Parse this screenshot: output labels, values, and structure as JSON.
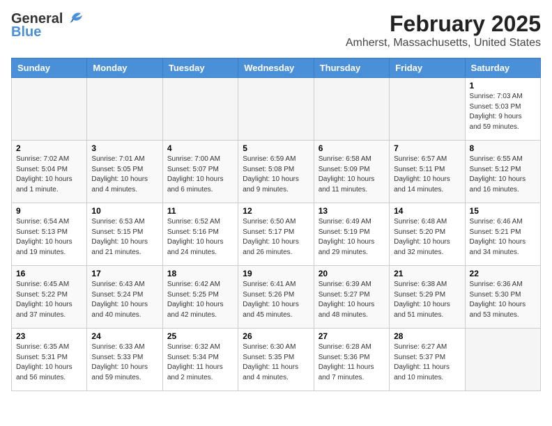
{
  "app": {
    "logo_general": "General",
    "logo_blue": "Blue",
    "title": "February 2025",
    "subtitle": "Amherst, Massachusetts, United States"
  },
  "calendar": {
    "headers": [
      "Sunday",
      "Monday",
      "Tuesday",
      "Wednesday",
      "Thursday",
      "Friday",
      "Saturday"
    ],
    "weeks": [
      [
        {
          "day": "",
          "info": ""
        },
        {
          "day": "",
          "info": ""
        },
        {
          "day": "",
          "info": ""
        },
        {
          "day": "",
          "info": ""
        },
        {
          "day": "",
          "info": ""
        },
        {
          "day": "",
          "info": ""
        },
        {
          "day": "1",
          "info": "Sunrise: 7:03 AM\nSunset: 5:03 PM\nDaylight: 9 hours\nand 59 minutes."
        }
      ],
      [
        {
          "day": "2",
          "info": "Sunrise: 7:02 AM\nSunset: 5:04 PM\nDaylight: 10 hours\nand 1 minute."
        },
        {
          "day": "3",
          "info": "Sunrise: 7:01 AM\nSunset: 5:05 PM\nDaylight: 10 hours\nand 4 minutes."
        },
        {
          "day": "4",
          "info": "Sunrise: 7:00 AM\nSunset: 5:07 PM\nDaylight: 10 hours\nand 6 minutes."
        },
        {
          "day": "5",
          "info": "Sunrise: 6:59 AM\nSunset: 5:08 PM\nDaylight: 10 hours\nand 9 minutes."
        },
        {
          "day": "6",
          "info": "Sunrise: 6:58 AM\nSunset: 5:09 PM\nDaylight: 10 hours\nand 11 minutes."
        },
        {
          "day": "7",
          "info": "Sunrise: 6:57 AM\nSunset: 5:11 PM\nDaylight: 10 hours\nand 14 minutes."
        },
        {
          "day": "8",
          "info": "Sunrise: 6:55 AM\nSunset: 5:12 PM\nDaylight: 10 hours\nand 16 minutes."
        }
      ],
      [
        {
          "day": "9",
          "info": "Sunrise: 6:54 AM\nSunset: 5:13 PM\nDaylight: 10 hours\nand 19 minutes."
        },
        {
          "day": "10",
          "info": "Sunrise: 6:53 AM\nSunset: 5:15 PM\nDaylight: 10 hours\nand 21 minutes."
        },
        {
          "day": "11",
          "info": "Sunrise: 6:52 AM\nSunset: 5:16 PM\nDaylight: 10 hours\nand 24 minutes."
        },
        {
          "day": "12",
          "info": "Sunrise: 6:50 AM\nSunset: 5:17 PM\nDaylight: 10 hours\nand 26 minutes."
        },
        {
          "day": "13",
          "info": "Sunrise: 6:49 AM\nSunset: 5:19 PM\nDaylight: 10 hours\nand 29 minutes."
        },
        {
          "day": "14",
          "info": "Sunrise: 6:48 AM\nSunset: 5:20 PM\nDaylight: 10 hours\nand 32 minutes."
        },
        {
          "day": "15",
          "info": "Sunrise: 6:46 AM\nSunset: 5:21 PM\nDaylight: 10 hours\nand 34 minutes."
        }
      ],
      [
        {
          "day": "16",
          "info": "Sunrise: 6:45 AM\nSunset: 5:22 PM\nDaylight: 10 hours\nand 37 minutes."
        },
        {
          "day": "17",
          "info": "Sunrise: 6:43 AM\nSunset: 5:24 PM\nDaylight: 10 hours\nand 40 minutes."
        },
        {
          "day": "18",
          "info": "Sunrise: 6:42 AM\nSunset: 5:25 PM\nDaylight: 10 hours\nand 42 minutes."
        },
        {
          "day": "19",
          "info": "Sunrise: 6:41 AM\nSunset: 5:26 PM\nDaylight: 10 hours\nand 45 minutes."
        },
        {
          "day": "20",
          "info": "Sunrise: 6:39 AM\nSunset: 5:27 PM\nDaylight: 10 hours\nand 48 minutes."
        },
        {
          "day": "21",
          "info": "Sunrise: 6:38 AM\nSunset: 5:29 PM\nDaylight: 10 hours\nand 51 minutes."
        },
        {
          "day": "22",
          "info": "Sunrise: 6:36 AM\nSunset: 5:30 PM\nDaylight: 10 hours\nand 53 minutes."
        }
      ],
      [
        {
          "day": "23",
          "info": "Sunrise: 6:35 AM\nSunset: 5:31 PM\nDaylight: 10 hours\nand 56 minutes."
        },
        {
          "day": "24",
          "info": "Sunrise: 6:33 AM\nSunset: 5:33 PM\nDaylight: 10 hours\nand 59 minutes."
        },
        {
          "day": "25",
          "info": "Sunrise: 6:32 AM\nSunset: 5:34 PM\nDaylight: 11 hours\nand 2 minutes."
        },
        {
          "day": "26",
          "info": "Sunrise: 6:30 AM\nSunset: 5:35 PM\nDaylight: 11 hours\nand 4 minutes."
        },
        {
          "day": "27",
          "info": "Sunrise: 6:28 AM\nSunset: 5:36 PM\nDaylight: 11 hours\nand 7 minutes."
        },
        {
          "day": "28",
          "info": "Sunrise: 6:27 AM\nSunset: 5:37 PM\nDaylight: 11 hours\nand 10 minutes."
        },
        {
          "day": "",
          "info": ""
        }
      ]
    ]
  }
}
